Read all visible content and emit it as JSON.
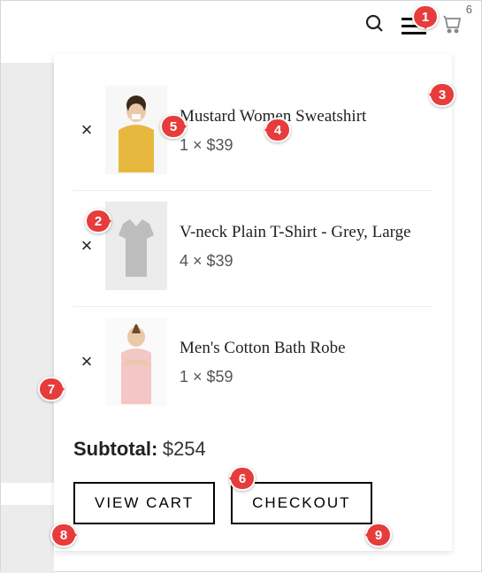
{
  "header": {
    "cart_count": "6"
  },
  "cart": {
    "items": [
      {
        "remove": "×",
        "title": "Mustard Women Sweatshirt",
        "qty_price": "1 × $39"
      },
      {
        "remove": "×",
        "title": "V-neck Plain T-Shirt - Grey, Large",
        "qty_price": "4 × $39"
      },
      {
        "remove": "×",
        "title": "Men's Cotton Bath Robe",
        "qty_price": "1 × $59"
      }
    ],
    "subtotal_label": "Subtotal:",
    "subtotal_value": "$254",
    "view_cart_label": "VIEW CART",
    "checkout_label": "CHECKOUT"
  },
  "markers": {
    "m1": "1",
    "m2": "2",
    "m3": "3",
    "m4": "4",
    "m5": "5",
    "m6": "6",
    "m7": "7",
    "m8": "8",
    "m9": "9"
  }
}
